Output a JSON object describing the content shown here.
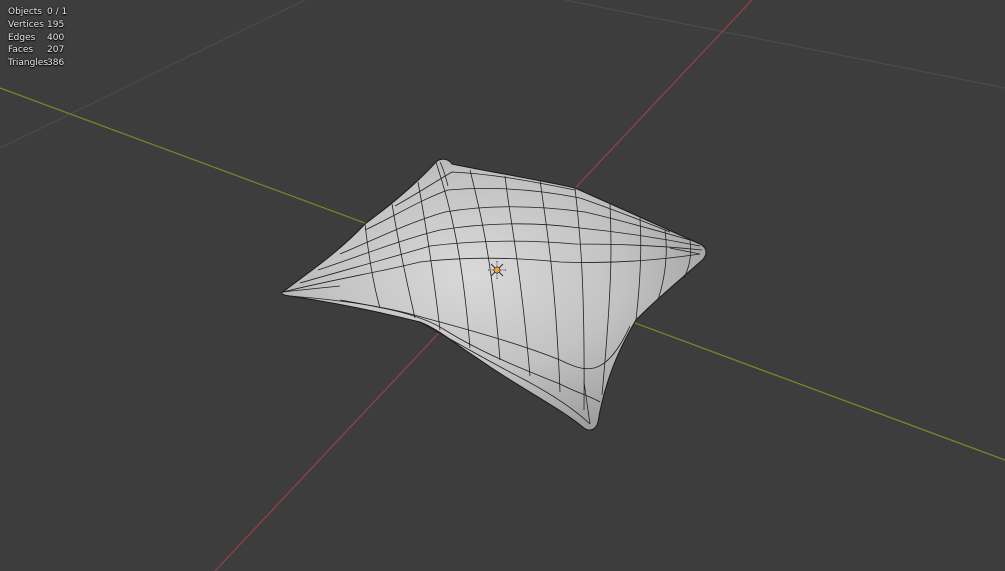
{
  "stats": [
    {
      "label": "Objects",
      "value": "0 / 1"
    },
    {
      "label": "Vertices",
      "value": "195"
    },
    {
      "label": "Edges",
      "value": "400"
    },
    {
      "label": "Faces",
      "value": "207"
    },
    {
      "label": "Triangles",
      "value": "386"
    }
  ],
  "colors": {
    "background": "#3d3d3d",
    "x_axis": "#9b3f4c",
    "y_axis": "#6e8f2a",
    "grid": "#4e4e4e",
    "mesh_fill": "#c4c4c4",
    "wire": "#1a1a1a",
    "origin": "#e8a33a"
  }
}
